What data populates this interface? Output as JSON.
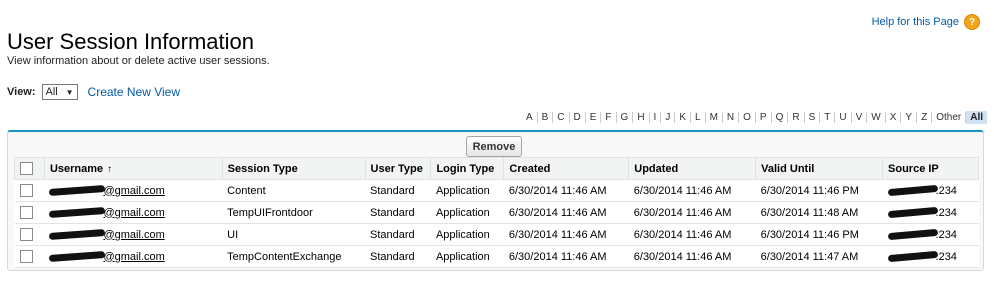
{
  "page": {
    "title": "User Session Information",
    "help_link": "Help for this Page",
    "description": "View information about or delete active user sessions."
  },
  "view": {
    "label": "View:",
    "selected": "All",
    "create_link": "Create New View"
  },
  "alphabet": [
    "A",
    "B",
    "C",
    "D",
    "E",
    "F",
    "G",
    "H",
    "I",
    "J",
    "K",
    "L",
    "M",
    "N",
    "O",
    "P",
    "Q",
    "R",
    "S",
    "T",
    "U",
    "V",
    "W",
    "X",
    "Y",
    "Z",
    "Other",
    "All"
  ],
  "alphabet_active": "All",
  "table": {
    "remove_label": "Remove",
    "sort_indicator": "↑",
    "columns": [
      "Username",
      "Session Type",
      "User Type",
      "Login Type",
      "Created",
      "Updated",
      "Valid Until",
      "Source IP"
    ],
    "rows": [
      {
        "username": "@gmail.com",
        "session_type": "Content",
        "user_type": "Standard",
        "login_type": "Application",
        "created": "6/30/2014 11:46 AM",
        "updated": "6/30/2014 11:46 AM",
        "valid_until": "6/30/2014 11:46 PM",
        "source_ip": ".234"
      },
      {
        "username": "@gmail.com",
        "session_type": "TempUIFrontdoor",
        "user_type": "Standard",
        "login_type": "Application",
        "created": "6/30/2014 11:46 AM",
        "updated": "6/30/2014 11:46 AM",
        "valid_until": "6/30/2014 11:48 AM",
        "source_ip": ".234"
      },
      {
        "username": "@gmail.com",
        "session_type": "UI",
        "user_type": "Standard",
        "login_type": "Application",
        "created": "6/30/2014 11:46 AM",
        "updated": "6/30/2014 11:46 AM",
        "valid_until": "6/30/2014 11:46 PM",
        "source_ip": ".234"
      },
      {
        "username": "@gmail.com",
        "session_type": "TempContentExchange",
        "user_type": "Standard",
        "login_type": "Application",
        "created": "6/30/2014 11:46 AM",
        "updated": "6/30/2014 11:46 AM",
        "valid_until": "6/30/2014 11:47 AM",
        "source_ip": ".234"
      }
    ]
  },
  "colors": {
    "link": "#015ba7",
    "panel_border_top": "#1797c0",
    "help_icon": "#f2a51a",
    "alpha_active_bg": "#cfe0f1"
  }
}
